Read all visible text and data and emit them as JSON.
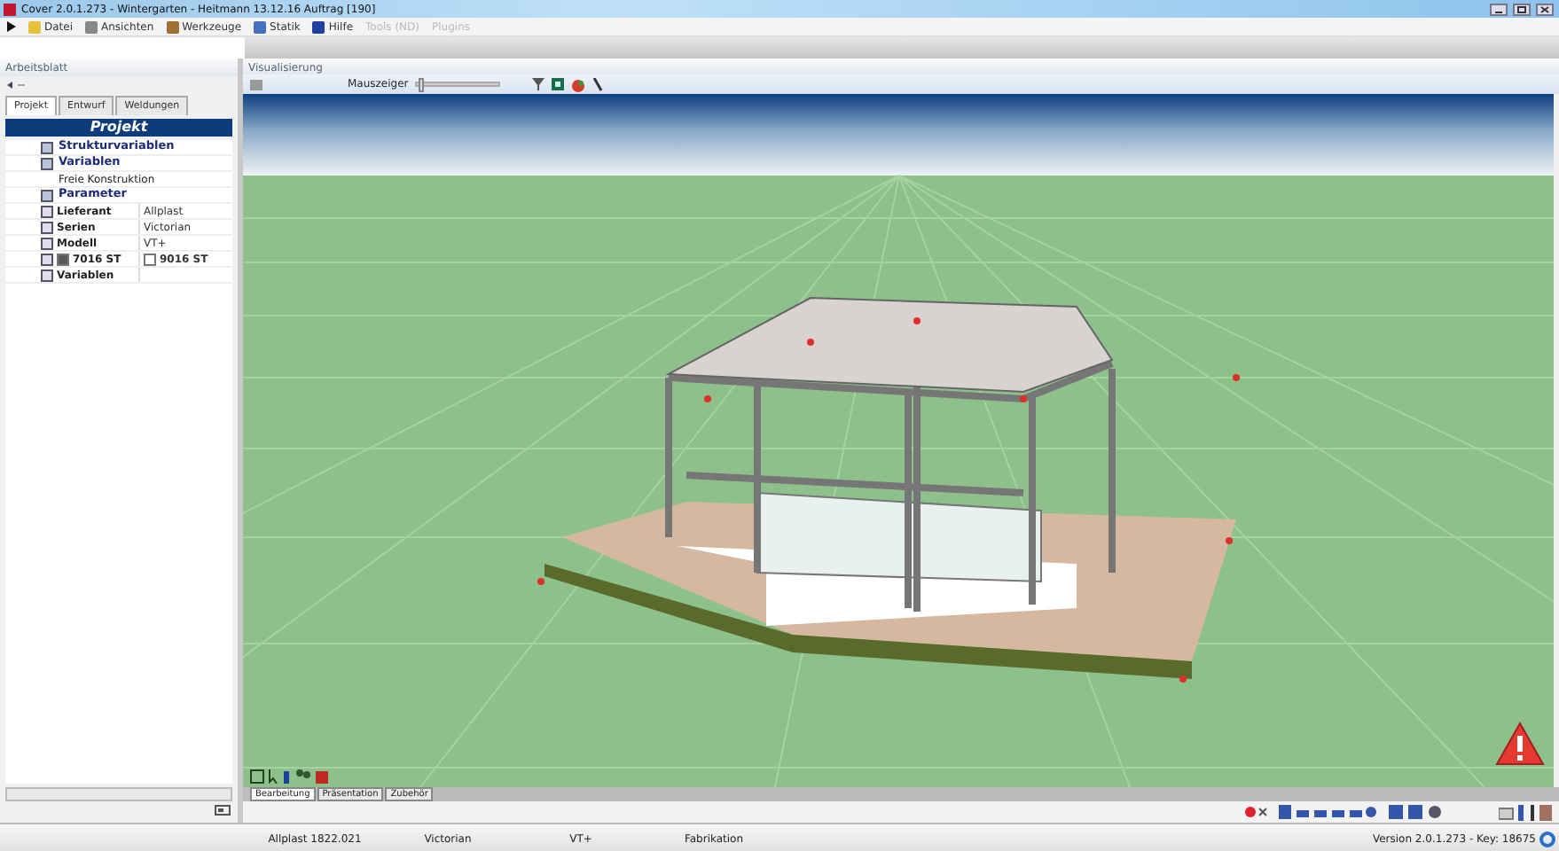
{
  "window": {
    "title": "Cover 2.0.1.273 - Wintergarten - Heitmann 13.12.16 Auftrag [190]"
  },
  "menu": [
    {
      "label": "Datei",
      "disabled": false
    },
    {
      "label": "Ansichten",
      "disabled": false
    },
    {
      "label": "Werkzeuge",
      "disabled": false
    },
    {
      "label": "Statik",
      "disabled": false
    },
    {
      "label": "Hilfe",
      "disabled": false
    },
    {
      "label": "Tools (ND)",
      "disabled": true
    },
    {
      "label": "Plugins",
      "disabled": true
    }
  ],
  "worksheet": {
    "title": "Arbeitsblatt",
    "tabs": [
      {
        "label": "Projekt",
        "selected": true
      },
      {
        "label": "Entwurf",
        "selected": false
      },
      {
        "label": "Weldungen",
        "selected": false
      }
    ],
    "header": "Projekt",
    "tree": [
      {
        "label": "Strukturvariablen"
      },
      {
        "label": "Variablen",
        "children": [
          {
            "label": "Freie Konstruktion"
          }
        ]
      },
      {
        "label": "Parameter",
        "properties": [
          {
            "kind": "text",
            "label": "Lieferant",
            "value": "Allplast"
          },
          {
            "kind": "text",
            "label": "Serien",
            "value": "Victorian"
          },
          {
            "kind": "text",
            "label": "Modell",
            "value": "VT+"
          },
          {
            "kind": "colors",
            "label": "7016 ST",
            "color": "#5a5a5a",
            "value": {
              "text": "9016 ST",
              "color": "#ffffff"
            }
          },
          {
            "kind": "text",
            "label": "Variablen"
          }
        ]
      }
    ]
  },
  "viewport": {
    "title": "Visualisierung",
    "pointer_label": "Mauszeiger",
    "pointer": {
      "level": 0.02
    },
    "tabs": [
      {
        "label": "Bearbeitung",
        "selected": true
      },
      {
        "label": "Präsentation",
        "selected": false
      },
      {
        "label": "Zubehör",
        "selected": false
      }
    ]
  },
  "status_bar": {
    "fields": [
      "Allplast 1822.021",
      "Victorian",
      "VT+",
      "Fabrikation"
    ],
    "version": "Version 2.0.1.273 - Key: 18675"
  }
}
